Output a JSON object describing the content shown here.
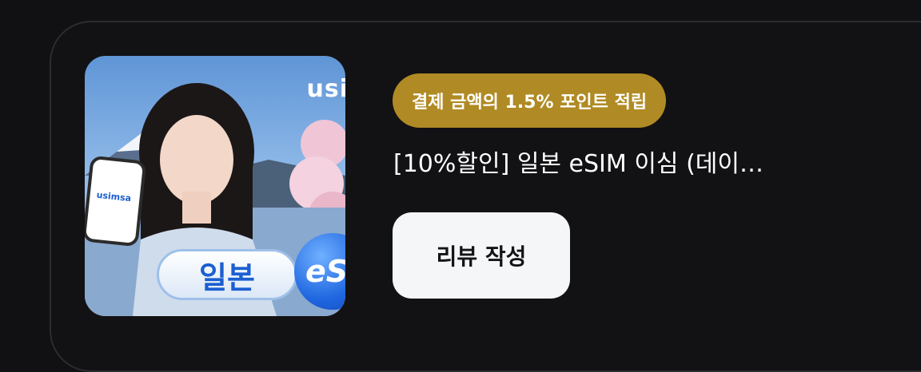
{
  "product": {
    "thumbnail": {
      "brand_text": "usi",
      "phone_brand_text": "usimsa",
      "country_label": "일본",
      "esim_label": "eS",
      "colors": {
        "sky": "#5f95d6",
        "pill_text": "#1b5fd1",
        "bubble": "#1f66e0"
      }
    },
    "badge": {
      "text": "결제 금액의 1.5% 포인트 적립",
      "color": "#b08a24"
    },
    "title": "[10%할인] 일본 eSIM 이심 (데이…",
    "review_button": {
      "label": "리뷰 작성"
    }
  }
}
